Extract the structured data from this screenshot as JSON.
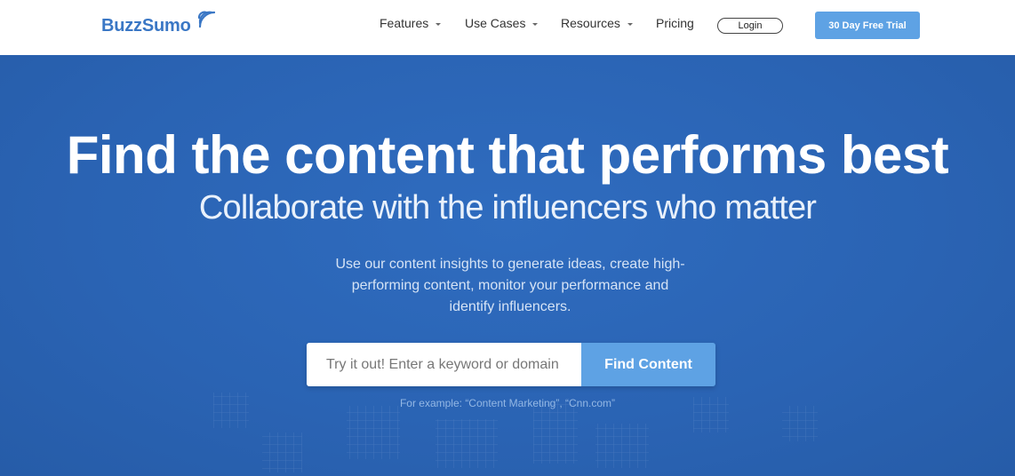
{
  "header": {
    "logo_text": "BuzzSumo",
    "nav": [
      {
        "label": "Features",
        "dropdown": true
      },
      {
        "label": "Use Cases",
        "dropdown": true
      },
      {
        "label": "Resources",
        "dropdown": true
      },
      {
        "label": "Pricing",
        "dropdown": false
      }
    ],
    "login_label": "Login",
    "trial_label": "30 Day Free Trial"
  },
  "hero": {
    "headline": "Find the content that performs best",
    "subheadline": "Collaborate with the influencers who matter",
    "description": "Use our content insights to generate ideas, create high-performing content, monitor your performance and identify influencers.",
    "search": {
      "placeholder": "Try it out! Enter a keyword or domain",
      "value": "",
      "button_label": "Find Content"
    },
    "example_text": "For example: “Content Marketing”, “Cnn.com”"
  },
  "colors": {
    "brand_blue": "#3a77c5",
    "accent_blue": "#5ea2e4",
    "hero_bg": "#2a63b3"
  },
  "icons": {
    "logo_signal": "signal-waves-icon",
    "dropdown": "caret-down-icon"
  }
}
